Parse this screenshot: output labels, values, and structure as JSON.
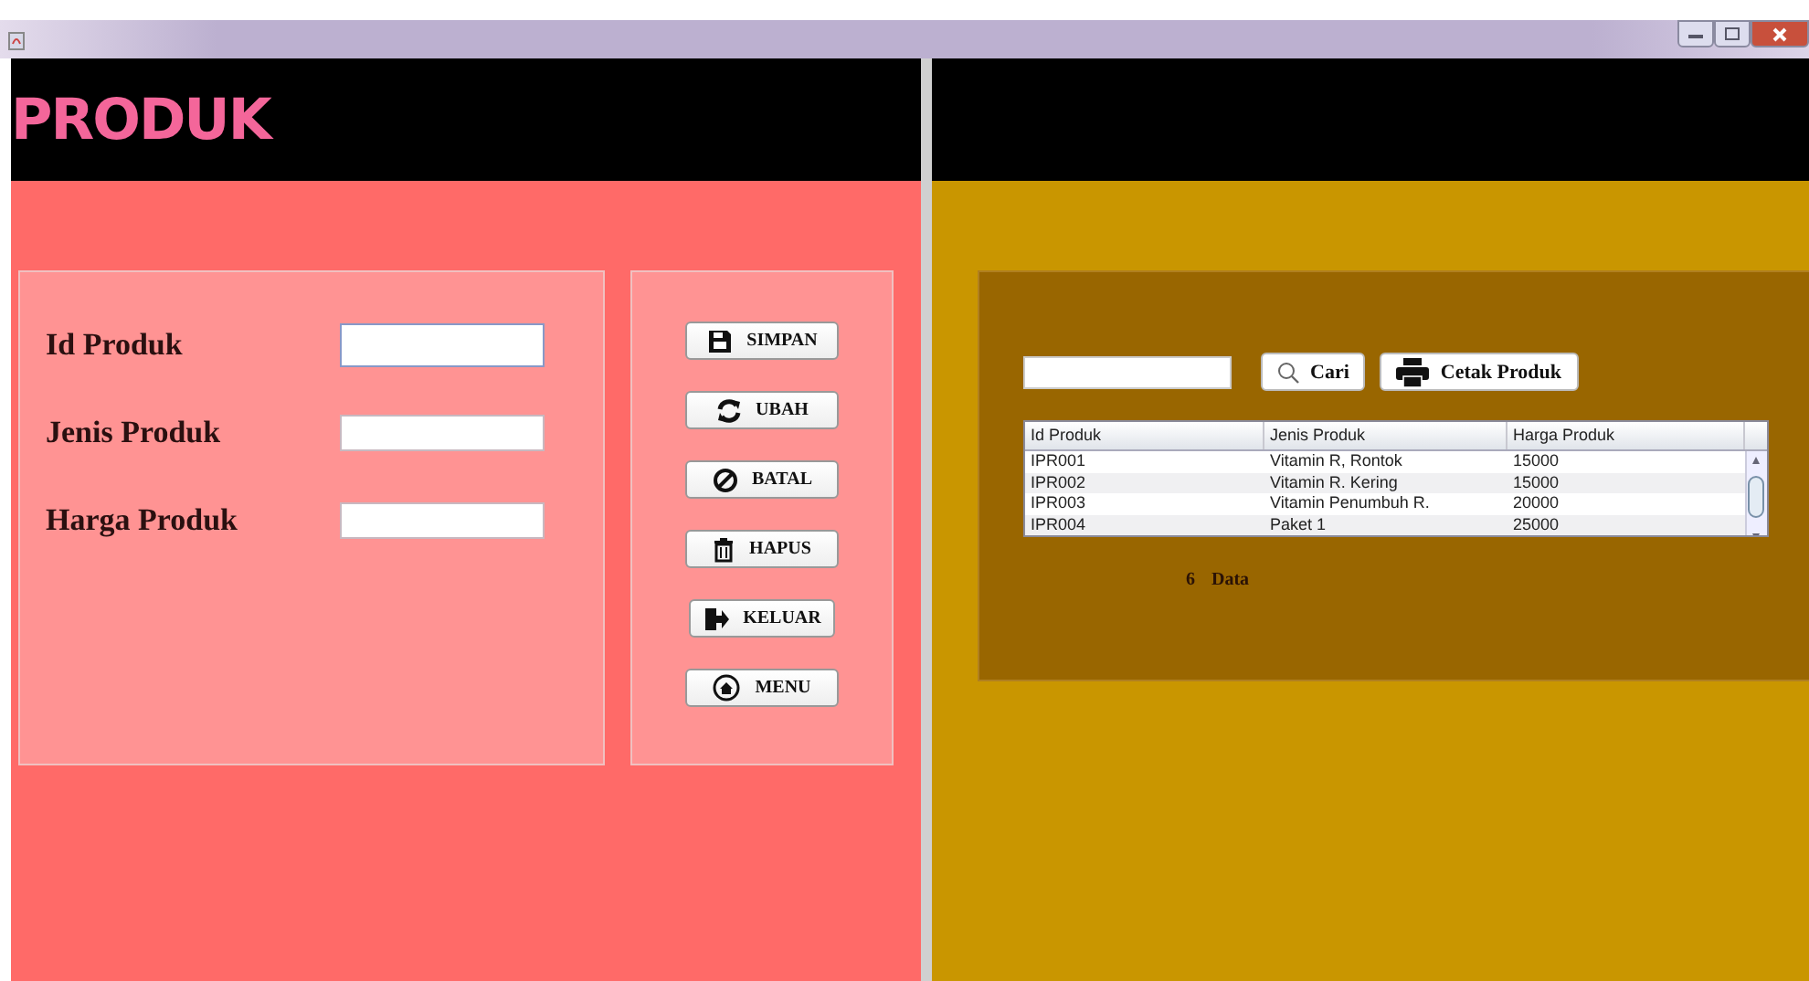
{
  "title": "PRODUK",
  "fields": [
    {
      "label": "Id Produk",
      "focused": true
    },
    {
      "label": "Jenis Produk",
      "focused": false
    },
    {
      "label": "Harga Produk",
      "focused": false
    }
  ],
  "buttons": [
    {
      "label": "SIMPAN",
      "kind": "save"
    },
    {
      "label": "UBAH",
      "kind": "refresh"
    },
    {
      "label": "BATAL",
      "kind": "cancel"
    },
    {
      "label": "HAPUS",
      "kind": "trash"
    },
    {
      "label": "KELUAR",
      "kind": "exit"
    },
    {
      "label": "MENU",
      "kind": "home"
    }
  ],
  "search": {
    "button": "Cari",
    "print_button": "Cetak Produk"
  },
  "table": {
    "columns": [
      "Id Produk",
      "Jenis Produk",
      "Harga Produk"
    ],
    "rows": [
      [
        "IPR001",
        "Vitamin R, Rontok",
        "15000"
      ],
      [
        "IPR002",
        "Vitamin R. Kering",
        "15000"
      ],
      [
        "IPR003",
        "Vitamin Penumbuh R.",
        "20000"
      ],
      [
        "IPR004",
        "Paket 1",
        "25000"
      ]
    ]
  },
  "count": {
    "value": "6",
    "label": "Data"
  }
}
